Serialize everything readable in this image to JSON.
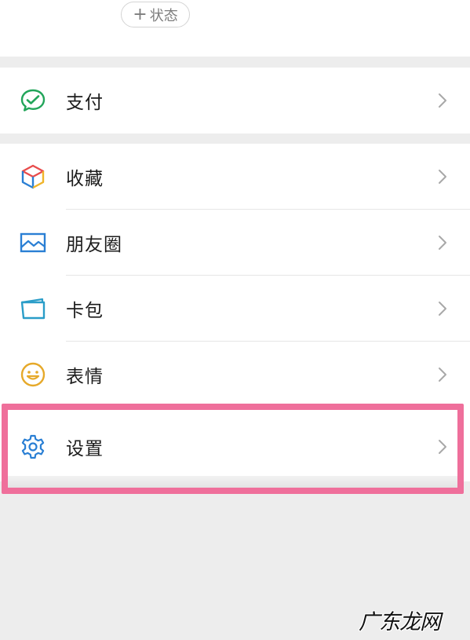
{
  "header": {
    "status_plus": "+",
    "status_label": "状态"
  },
  "menu": {
    "pay": {
      "label": "支付",
      "icon": "wechat-pay-icon"
    },
    "favorites": {
      "label": "收藏",
      "icon": "favorites-cube-icon"
    },
    "moments": {
      "label": "朋友圈",
      "icon": "moments-photo-icon"
    },
    "cards": {
      "label": "卡包",
      "icon": "card-wallet-icon"
    },
    "stickers": {
      "label": "表情",
      "icon": "smiley-icon"
    },
    "settings": {
      "label": "设置",
      "icon": "gear-icon"
    }
  },
  "watermark": "广东龙网",
  "colors": {
    "highlight": "#ef6f9b",
    "pay_green": "#22a55a",
    "blue": "#2a7fd4",
    "emoji_yellow": "#e6a92a"
  }
}
